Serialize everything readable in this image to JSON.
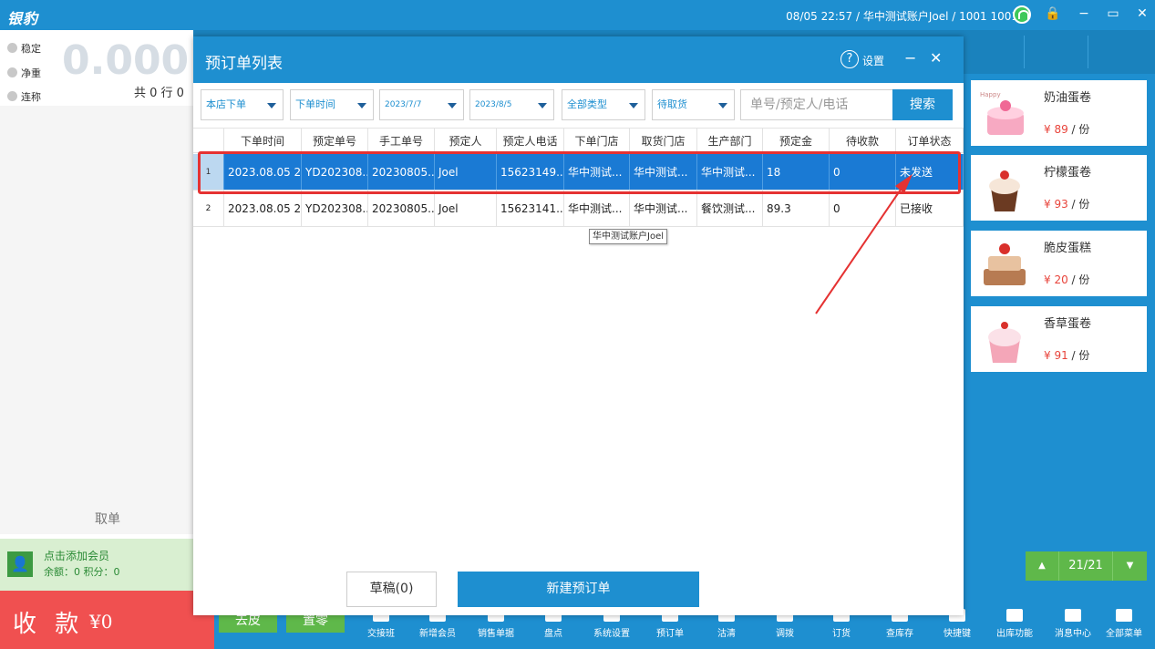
{
  "app": {
    "logo": "银豹",
    "status": "08/05 22:57 / 华中测试账户Joel / 1001 1001"
  },
  "window_controls": {
    "lock": "🔒",
    "minimize": "−",
    "restore": "▭",
    "close": "✕"
  },
  "left": {
    "scale_labels": [
      "稳定",
      "净重",
      "连称"
    ],
    "weight": "0.000",
    "row_count": "共 0 行 0",
    "take_order": "取单",
    "member": {
      "line1": "点击添加会员",
      "line2": "余额：0  积分：0"
    },
    "pay_label": "收 款",
    "pay_value": "¥0"
  },
  "bottom": {
    "btn_discard": "去皮",
    "btn_zero": "置零",
    "items": [
      "交接班",
      "新增会员",
      "销售单据",
      "盘点",
      "系统设置",
      "预订单",
      "沽清",
      "调拨",
      "订货",
      "查库存",
      "快捷键",
      "出库功能",
      "消息中心",
      "全部菜单"
    ]
  },
  "products": [
    {
      "name": "奶油蛋卷",
      "price": "¥ 89",
      "unit": " / 份"
    },
    {
      "name": "柠檬蛋卷",
      "price": "¥ 93",
      "unit": " / 份"
    },
    {
      "name": "脆皮蛋糕",
      "price": "¥ 20",
      "unit": " / 份"
    },
    {
      "name": "香草蛋卷",
      "price": "¥ 91",
      "unit": " / 份"
    }
  ],
  "pager": {
    "up": "▲",
    "text": "21/21",
    "down": "▼"
  },
  "dialog": {
    "title": "预订单列表",
    "help": "?",
    "settings": "设置",
    "minimize": "−",
    "close": "✕",
    "filters": {
      "store": "本店下单",
      "time_type": "下单时间",
      "date_from": "2023/7/7",
      "date_to": "2023/8/5",
      "type": "全部类型",
      "status": "待取货",
      "search_placeholder": "单号/预定人/电话",
      "search_button": "搜索"
    },
    "columns": [
      "下单时间",
      "预定单号",
      "手工单号",
      "预定人",
      "预定人电话",
      "下单门店",
      "取货门店",
      "生产部门",
      "预定金",
      "待收款",
      "订单状态"
    ],
    "rows": [
      {
        "idx": "1",
        "cells": [
          "2023.08.05 2...",
          "YD202308...",
          "20230805...",
          "Joel",
          "15623149...",
          "华中测试...",
          "华中测试...",
          "华中测试...",
          "18",
          "0",
          "未发送"
        ]
      },
      {
        "idx": "2",
        "cells": [
          "2023.08.05 2...",
          "YD202308...",
          "20230805...",
          "Joel",
          "15623141...",
          "华中测试...",
          "华中测试...",
          "餐饮测试...",
          "89.3",
          "0",
          "已接收"
        ]
      }
    ],
    "tooltip": "华中测试账户Joel",
    "draft_button": "草稿(0)",
    "new_button": "新建预订单"
  }
}
